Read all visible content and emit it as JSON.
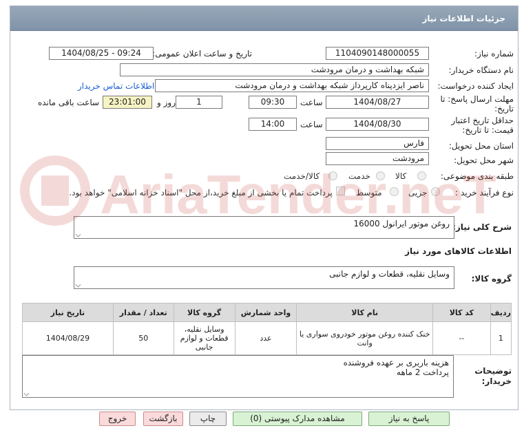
{
  "header": {
    "title": "جزئیات اطلاعات نیاز"
  },
  "form": {
    "need_number_label": "شماره نیاز:",
    "need_number": "1104090148000055",
    "announce_label": "تاریخ و ساعت اعلان عمومی:",
    "announce_value": "1404/08/25 - 09:24",
    "buyer_org_label": "نام دستگاه خریدار:",
    "buyer_org": "شبکه بهداشت و درمان مرودشت",
    "creator_label": "ایجاد کننده درخواست:",
    "creator": "ناصر ایزدپناه کارپرداز شبکه بهداشت و درمان مرودشت",
    "contact_link": "اطلاعات تماس خریدار",
    "deadline_label_1": "مهلت ارسال پاسخ: تا",
    "deadline_label_2": "تاریخ:",
    "deadline_date": "1404/08/27",
    "time_label": "ساعت",
    "deadline_time": "09:30",
    "day_count": "1",
    "day_label": "روز و",
    "remaining_time": "23:01:00",
    "remaining_label": "ساعت باقی مانده",
    "validity_label_1": "حداقل تاریخ اعتبار",
    "validity_label_2": "قیمت: تا تاریخ:",
    "validity_date": "1404/08/30",
    "validity_time": "14:00",
    "province_label": "استان محل تحویل:",
    "province": "فارس",
    "city_label": "شهر محل تحویل:",
    "city": "مرودشت",
    "category_label": "طبقه بندی موضوعی:",
    "category_options": [
      "کالا",
      "خدمت",
      "کالا/خدمت"
    ],
    "process_label": "نوع فرآیند خرید :",
    "process_options": [
      "جزیی",
      "متوسط"
    ],
    "payment_note": "پرداخت تمام یا بخشی از مبلغ خرید،از محل \"اسناد خزانه اسلامی\" خواهد بود.",
    "description_label": "شرح کلی نیاز:",
    "description": "روغن موتور ایرانول 16000",
    "goods_info_title": "اطلاعات کالاهای مورد نیاز",
    "goods_group_label": "گروه کالا:",
    "goods_group": "وسایل نقلیه، قطعات و لوازم جانبی",
    "buyer_notes_label_1": "توضیحات",
    "buyer_notes_label_2": "خریدار:",
    "buyer_notes_line1": "هزینه باربری بر عهده فروشنده",
    "buyer_notes_line2": "پرداخت 2 ماهه"
  },
  "table": {
    "headers": [
      "ردیف",
      "کد کالا",
      "نام کالا",
      "واحد شمارش",
      "گروه کالا",
      "تعداد / مقدار",
      "تاریخ نیاز"
    ],
    "rows": [
      [
        "1",
        "--",
        "خنک کننده روغن موتور خودروی سواری یا وانت",
        "عدد",
        "وسایل نقلیه، قطعات و لوازم جانبی",
        "50",
        "1404/08/29"
      ]
    ]
  },
  "buttons": {
    "reply": "پاسخ به نیاز",
    "docs": "مشاهده مدارک پیوستی (0)",
    "print": "چاپ",
    "back": "بازگشت",
    "exit": "خروج"
  },
  "watermark": {
    "text": "AriaTender.neT"
  },
  "colors": {
    "header_bg": "#8a9db1",
    "field_highlight": "#f7f3c4",
    "link": "#1a5fd0",
    "watermark": "#c0392b"
  }
}
